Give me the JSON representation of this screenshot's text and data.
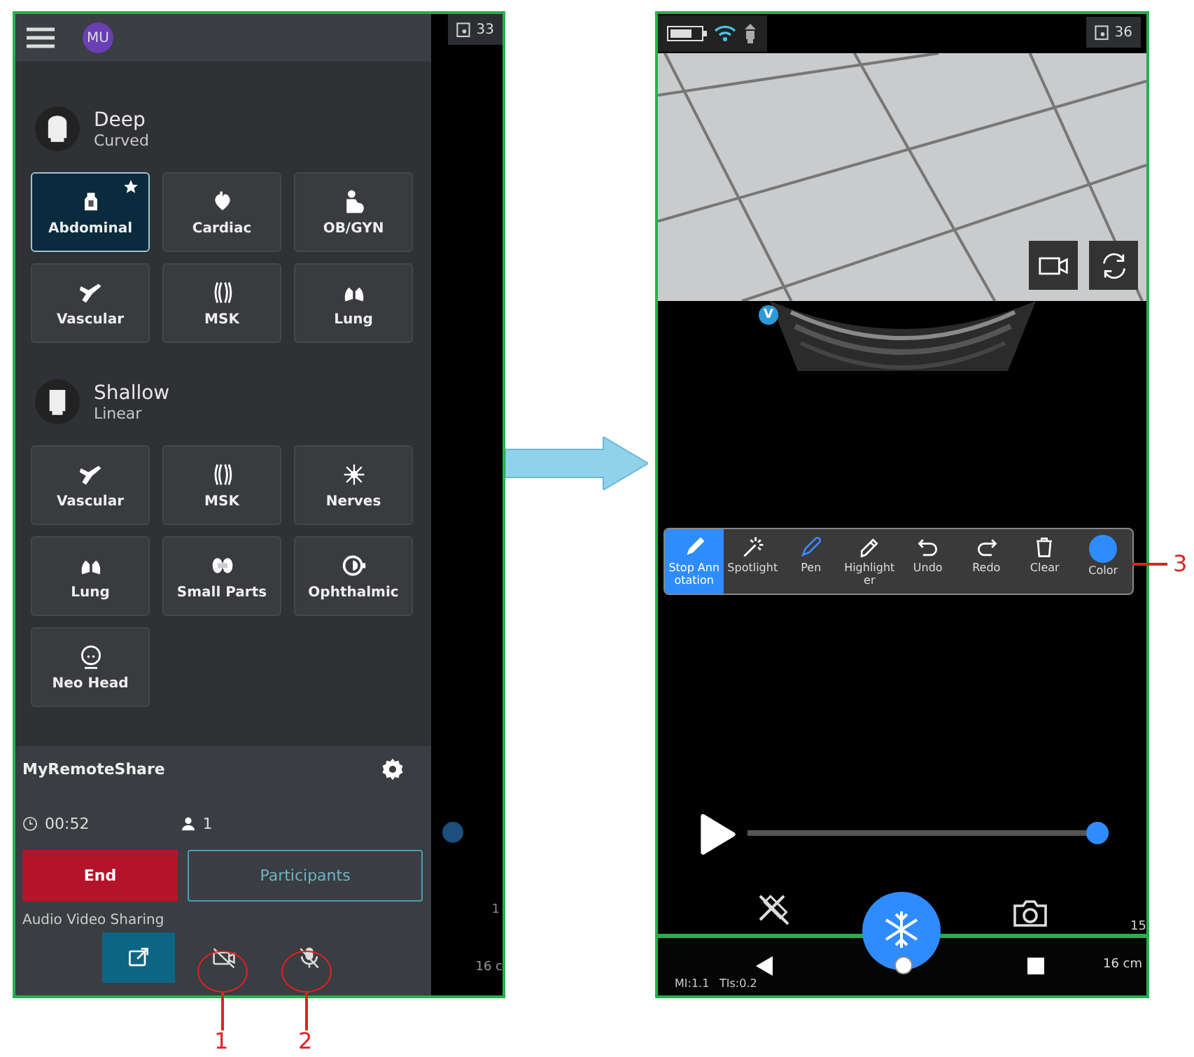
{
  "left_screen": {
    "avatar": "MU",
    "exam_count": "33",
    "probes": [
      {
        "name": "Deep",
        "type": "Curved",
        "kind": "curved",
        "presets": [
          {
            "label": "Abdominal",
            "selected": true,
            "favorite": true
          },
          {
            "label": "Cardiac",
            "selected": false,
            "favorite": false
          },
          {
            "label": "OB/GYN",
            "selected": false,
            "favorite": false
          },
          {
            "label": "Vascular",
            "selected": false,
            "favorite": false
          },
          {
            "label": "MSK",
            "selected": false,
            "favorite": false
          },
          {
            "label": "Lung",
            "selected": false,
            "favorite": false
          }
        ]
      },
      {
        "name": "Shallow",
        "type": "Linear",
        "kind": "linear",
        "presets": [
          {
            "label": "Vascular",
            "selected": false,
            "favorite": false
          },
          {
            "label": "MSK",
            "selected": false,
            "favorite": false
          },
          {
            "label": "Nerves",
            "selected": false,
            "favorite": false
          },
          {
            "label": "Lung",
            "selected": false,
            "favorite": false
          },
          {
            "label": "Small Parts",
            "selected": false,
            "favorite": false
          },
          {
            "label": "Ophthalmic",
            "selected": false,
            "favorite": false
          },
          {
            "label": "Neo Head",
            "selected": false,
            "favorite": false
          }
        ]
      }
    ],
    "session": {
      "name": "MyRemoteShare",
      "duration": "00:52",
      "participants_count": "1",
      "end_button": "End",
      "participants_button": "Participants",
      "section_label": "Audio Video Sharing"
    },
    "share_controls": [
      {
        "kind": "share",
        "selected": true
      },
      {
        "kind": "camera_off",
        "selected": false
      },
      {
        "kind": "mic_off",
        "selected": false
      }
    ],
    "scan_strip": {
      "depth_mark": "1",
      "depth": "16 c"
    }
  },
  "right_screen": {
    "exam_count": "36",
    "view_badge": "V",
    "annotation_tools": [
      {
        "label": "Stop Annotation",
        "kind": "stop",
        "selected": false
      },
      {
        "label": "Spotlight",
        "kind": "spotlight",
        "selected": false
      },
      {
        "label": "Pen",
        "kind": "pen",
        "selected": true
      },
      {
        "label": "Highlighter",
        "kind": "highlighter",
        "selected": false
      },
      {
        "label": "Undo",
        "kind": "undo",
        "selected": false
      },
      {
        "label": "Redo",
        "kind": "redo",
        "selected": false
      },
      {
        "label": "Clear",
        "kind": "clear",
        "selected": false
      },
      {
        "label": "Color",
        "kind": "color",
        "selected": false,
        "color": "#2f8cff"
      }
    ],
    "playback": {
      "level": 1
    },
    "depth_mark": "15",
    "depth": "16 cm",
    "mi": "MI:1.1",
    "tis": "TIs:0.2"
  },
  "callouts": [
    "1",
    "2",
    "3"
  ]
}
